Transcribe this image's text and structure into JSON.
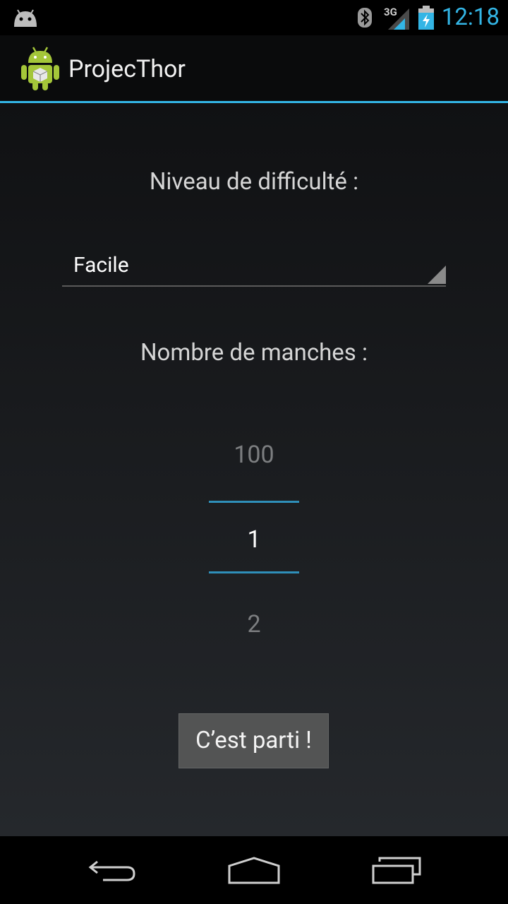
{
  "status_bar": {
    "network": "3G",
    "time": "12:18",
    "icons": [
      "android-notification-icon",
      "bluetooth-icon",
      "signal-icon",
      "battery-charging-icon"
    ],
    "accent_color": "#33b5e5"
  },
  "action_bar": {
    "icon": "android-robot-icon",
    "title": "ProjecThor"
  },
  "form": {
    "difficulty_label": "Niveau de difficulté :",
    "difficulty_value": "Facile",
    "rounds_label": "Nombre de manches :",
    "rounds_picker": {
      "prev": "100",
      "current": "1",
      "next": "2"
    },
    "start_button": "C’est parti !"
  },
  "nav_bar": {
    "icons": [
      "back-icon",
      "home-icon",
      "recent-apps-icon"
    ]
  }
}
